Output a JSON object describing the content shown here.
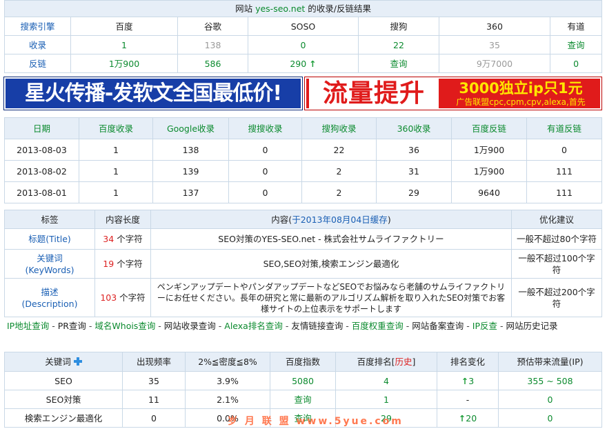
{
  "summary": {
    "title_pre": "网站",
    "domain": "yes-seo.net",
    "title_post": "的收录/反链结果",
    "engines_label": "搜索引擎",
    "engines": [
      "百度",
      "谷歌",
      "SOSO",
      "搜狗",
      "360",
      "有道"
    ],
    "index_label": "收录",
    "index_values": [
      "1",
      "138",
      "0",
      "22",
      "35",
      "查询"
    ],
    "backlink_label": "反链",
    "backlink_values": [
      "1万900",
      "586",
      "290",
      "查询",
      "9万7000",
      "0"
    ]
  },
  "banner": {
    "left_text": "星火传播-发软文全国最低价!",
    "right_big": "流量提升",
    "right_line1": "3000独立ip只1元",
    "right_line2": "广告联盟cpc,cpm,cpv,alexa,首先"
  },
  "history": {
    "headers": [
      "日期",
      "百度收录",
      "Google收录",
      "搜搜收录",
      "搜狗收录",
      "360收录",
      "百度反链",
      "有道反链"
    ],
    "rows": [
      [
        "2013-08-03",
        "1",
        "138",
        "0",
        "22",
        "36",
        "1万900",
        "0"
      ],
      [
        "2013-08-02",
        "1",
        "139",
        "0",
        "2",
        "31",
        "1万900",
        "111"
      ],
      [
        "2013-08-01",
        "1",
        "137",
        "0",
        "2",
        "29",
        "9640",
        "111"
      ]
    ]
  },
  "meta": {
    "h_tag": "标签",
    "h_len": "内容长度",
    "h_content_pre": "内容(",
    "h_content_link": "于2013年08月04日缓存",
    "h_content_post": ")",
    "h_advice": "优化建议",
    "unit": "个字符",
    "rows": [
      {
        "tag": "标题(Title)",
        "len": "34",
        "content": "SEO対策のYES-SEO.net - 株式会社サムライファクトリー",
        "advice": "一般不超过80个字符"
      },
      {
        "tag": "关键词\n(KeyWords)",
        "len": "19",
        "content": "SEO,SEO対策,検索エンジン最適化",
        "advice": "一般不超过100个字符"
      },
      {
        "tag": "描述\n(Description)",
        "len": "103",
        "content": "ペンギンアップデートやパンダアップデートなどSEOでお悩みなら老舗のサムライファクトリーにお任せください。長年の研究と常に最新のアルゴリズム解析を取り入れたSEO対策でお客様サイトの上位表示をサポートします",
        "advice": "一般不超过200个字符"
      }
    ]
  },
  "links": [
    {
      "text": "IP地址查询",
      "color": "g"
    },
    {
      "text": "PR查询",
      "color": "k"
    },
    {
      "text": "域名Whois查询",
      "color": "g"
    },
    {
      "text": "网站收录查询",
      "color": "k"
    },
    {
      "text": "Alexa排名查询",
      "color": "g"
    },
    {
      "text": "友情链接查询",
      "color": "k"
    },
    {
      "text": "百度权重查询",
      "color": "g"
    },
    {
      "text": "网站备案查询",
      "color": "k"
    },
    {
      "text": "IP反查",
      "color": "g"
    },
    {
      "text": "网站历史记录",
      "color": "k"
    }
  ],
  "links_sep": " - ",
  "keywords": {
    "h_kw": "关键词",
    "h_freq": "出现频率",
    "h_density": "2%≦密度≦8%",
    "h_index": "百度指数",
    "h_rank_pre": "百度排名[",
    "h_rank_link": "历史",
    "h_rank_post": "]",
    "h_change": "排名变化",
    "h_traffic": "预估带来流量(IP)",
    "rows": [
      {
        "kw": "SEO",
        "freq": "35",
        "density": "3.9%",
        "index": "5080",
        "rank": "4",
        "change": "3",
        "change_dir": "up",
        "traffic": "355 ~ 508"
      },
      {
        "kw": "SEO対策",
        "freq": "11",
        "density": "2.1%",
        "index": "查询",
        "rank": "1",
        "change": "-",
        "change_dir": "none",
        "traffic": "0"
      },
      {
        "kw": "検索エンジン最適化",
        "freq": "0",
        "density": "0.0%",
        "index": "查询",
        "rank": "29",
        "change": "20",
        "change_dir": "up",
        "traffic": "0"
      }
    ]
  },
  "watermark": "岁 月 联 盟  www.5yue.com",
  "colors": {
    "green": "#0b8a2e",
    "blue": "#1a5fb4",
    "red": "#dd2222",
    "header_bg": "#e6eef7",
    "border": "#c9d8e6",
    "banner_blue": "#173ea7",
    "banner_red": "#e01b1b",
    "banner_yellow": "#ffe600"
  },
  "icons": {
    "up": "arrow-up-icon",
    "add": "plus-icon"
  }
}
